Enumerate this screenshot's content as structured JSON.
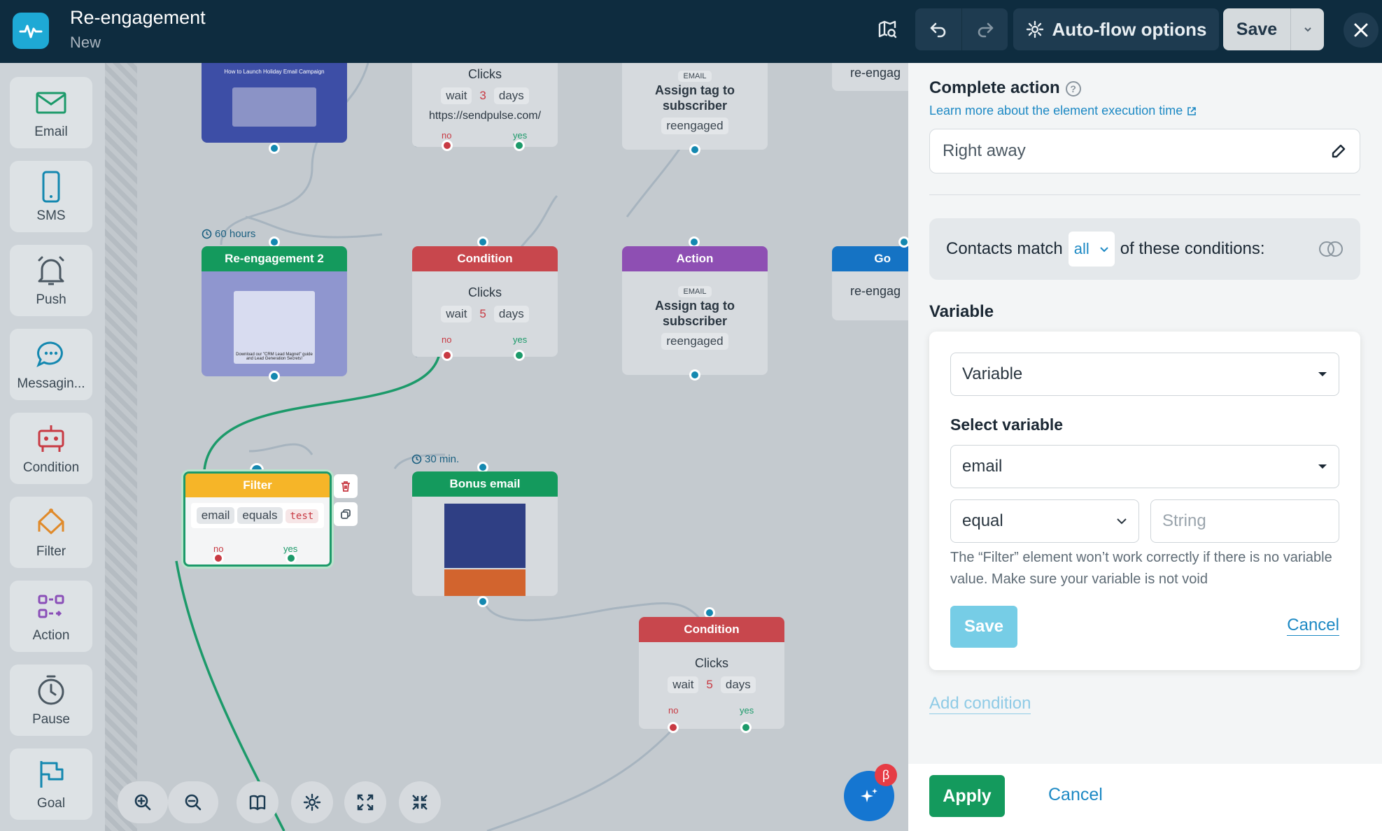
{
  "header": {
    "title": "Re-engagement",
    "subtitle": "New",
    "auto_flow_label": "Auto-flow options",
    "save_label": "Save"
  },
  "toolbox": [
    {
      "label": "Email",
      "icon": "envelope-icon"
    },
    {
      "label": "SMS",
      "icon": "phone-icon"
    },
    {
      "label": "Push",
      "icon": "bell-icon"
    },
    {
      "label": "Messagin...",
      "icon": "chat-bubble-icon"
    },
    {
      "label": "Condition",
      "icon": "condition-icon"
    },
    {
      "label": "Filter",
      "icon": "filter-icon"
    },
    {
      "label": "Action",
      "icon": "action-icon"
    },
    {
      "label": "Pause",
      "icon": "clock-icon"
    },
    {
      "label": "Goal",
      "icon": "flag-icon"
    }
  ],
  "canvas": {
    "top_clicks": {
      "title": "Clicks",
      "wait": "wait",
      "n": "3",
      "unit": "days",
      "url": "https://sendpulse.com/",
      "no": "no",
      "yes": "yes"
    },
    "top_action": {
      "badge": "EMAIL",
      "text": "Assign tag to subscriber",
      "tag": "reengaged"
    },
    "top_goal": {
      "text": "re-engag"
    },
    "email_thumb_text": "How to Launch Holiday Email Campaign",
    "reengagement2": {
      "delay": "60 hours",
      "title": "Re-engagement 2",
      "thumb_text": "Download our \"CRM Lead Magnet\" guide and Lead Generation Secrets!"
    },
    "condition1": {
      "title": "Condition",
      "label": "Clicks",
      "wait": "wait",
      "n": "5",
      "unit": "days",
      "no": "no",
      "yes": "yes"
    },
    "action1": {
      "title": "Action",
      "badge": "EMAIL",
      "text": "Assign tag to subscriber",
      "tag": "reengaged"
    },
    "goal1": {
      "title": "Go",
      "text": "re-engag"
    },
    "filter": {
      "title": "Filter",
      "field": "email",
      "op": "equals",
      "value": "test",
      "no": "no",
      "yes": "yes"
    },
    "bonus": {
      "delay": "30 min.",
      "title": "Bonus email"
    },
    "condition2": {
      "title": "Condition",
      "label": "Clicks",
      "wait": "wait",
      "n": "5",
      "unit": "days",
      "no": "no",
      "yes": "yes"
    },
    "beta_label": "β"
  },
  "panel": {
    "complete_action": "Complete action",
    "help": "?",
    "learn_more": "Learn more about the element execution time",
    "timing_value": "Right away",
    "contacts_prefix": "Contacts match",
    "match_value": "all",
    "contacts_suffix": "of these conditions:",
    "variable_heading": "Variable",
    "variable_type": "Variable",
    "select_variable_label": "Select variable",
    "variable_value": "email",
    "operator": "equal",
    "value_placeholder": "String",
    "note": "The “Filter” element won’t work correctly if there is no variable value. Make sure your variable is not void",
    "save_label": "Save",
    "cancel_label": "Cancel",
    "add_condition": "Add condition",
    "apply_label": "Apply",
    "footer_cancel": "Cancel"
  }
}
